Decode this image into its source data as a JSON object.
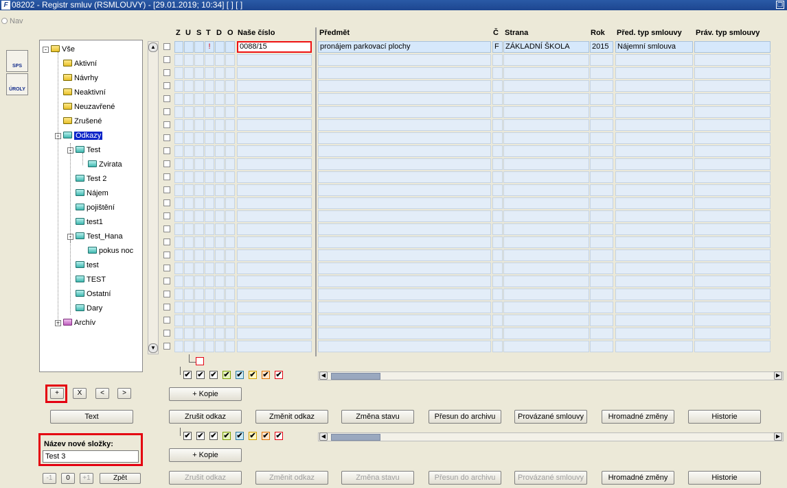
{
  "window": {
    "title": "08202 - Registr smluv (RSMLOUVY) - [29.01.2019; 10:34] [ ] [ ]"
  },
  "nav": {
    "label": "Nav"
  },
  "toolbar": {
    "sps_label": "SPS",
    "uroly_label": "ÚROLY"
  },
  "tree": {
    "items": [
      {
        "label": "Vše",
        "color": "y",
        "expand": "-"
      },
      {
        "label": "Aktivní",
        "color": "y"
      },
      {
        "label": "Návrhy",
        "color": "y"
      },
      {
        "label": "Neaktivní",
        "color": "y"
      },
      {
        "label": "Neuzavřené",
        "color": "y"
      },
      {
        "label": "Zrušené",
        "color": "y"
      },
      {
        "label": "Odkazy",
        "color": "c",
        "expand": "-",
        "selected": true
      },
      {
        "label": "Test",
        "color": "c",
        "expand": "-"
      },
      {
        "label": "Zvirata",
        "color": "c"
      },
      {
        "label": "Test 2",
        "color": "c"
      },
      {
        "label": "Nájem",
        "color": "c"
      },
      {
        "label": "pojištění",
        "color": "c"
      },
      {
        "label": "test1",
        "color": "c"
      },
      {
        "label": "Test_Hana",
        "color": "c",
        "expand": "-"
      },
      {
        "label": "pokus noc",
        "color": "c"
      },
      {
        "label": "test",
        "color": "c"
      },
      {
        "label": "TEST",
        "color": "c"
      },
      {
        "label": "Ostatní",
        "color": "c"
      },
      {
        "label": "Dary",
        "color": "c"
      },
      {
        "label": "Archív",
        "color": "p",
        "expand": "+"
      }
    ]
  },
  "tree_buttons": {
    "add": "+",
    "remove": "X",
    "prev": "<",
    "next": ">",
    "text": "Text"
  },
  "new_folder": {
    "label": "Název nové složky:",
    "value": "Test 3"
  },
  "bottom_left": {
    "minus": "-1",
    "zero": "0",
    "plus": "+1",
    "back": "Zpět"
  },
  "grid": {
    "columns": {
      "z": "Z",
      "u": "U",
      "s": "S",
      "t": "T",
      "d": "D",
      "o": "O",
      "nase_cislo": "Naše číslo",
      "predmet": "Předmět",
      "c": "Č",
      "strana": "Strana",
      "rok": "Rok",
      "pred_typ": "Před. typ smlouvy",
      "prav_typ": "Práv. typ smlouvy"
    },
    "first_row": {
      "t_flag": "!",
      "nase_cislo": "0088/15",
      "predmet": "pronájem parkovací plochy",
      "c": "F",
      "strana": "ZÁKLADNÍ ŠKOLA",
      "rok": "2015",
      "pred_typ": "Nájemní smlouva",
      "prav_typ": ""
    },
    "row_count": 24
  },
  "actions": {
    "kopie": "+ Kopie",
    "zrusit_odkaz": "Zrušit odkaz",
    "zmenit_odkaz": "Změnit odkaz",
    "zmena_stavu": "Změna stavu",
    "presun": "Přesun do archivu",
    "provazane": "Provázané smlouvy",
    "hromadne": "Hromadné změny",
    "historie": "Historie"
  },
  "colors": {
    "accent_red": "#e40010",
    "selection_blue": "#0a24c8",
    "row_blue": "#e3edf8"
  }
}
